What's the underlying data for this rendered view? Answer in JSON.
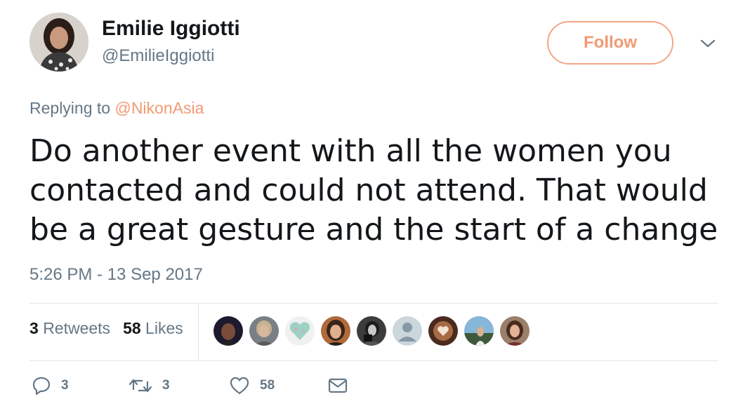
{
  "author": {
    "name": "Emilie Iggiotti",
    "handle": "@EmilieIggiotti",
    "avatar_icon": "profile-photo"
  },
  "follow_button": {
    "label": "Follow",
    "color": "#f09a73"
  },
  "more_menu": {
    "icon": "chevron-down-icon"
  },
  "reply": {
    "prefix": "Replying to",
    "mention": "@NikonAsia"
  },
  "tweet": {
    "text": "Do another event with all the women you contacted and could not attend. That would be a great gesture and the start of a change",
    "timestamp": "5:26 PM - 13 Sep 2017"
  },
  "stats": {
    "retweets_count": "3",
    "retweets_label": "Retweets",
    "likes_count": "58",
    "likes_label": "Likes"
  },
  "likers": [
    "liker-avatar-1",
    "liker-avatar-2",
    "liker-avatar-3",
    "liker-avatar-4",
    "liker-avatar-5",
    "liker-avatar-6",
    "liker-avatar-7",
    "liker-avatar-8",
    "liker-avatar-9"
  ],
  "actions": {
    "reply_count": "3",
    "retweet_count": "3",
    "like_count": "58"
  },
  "colors": {
    "accent": "#f09a73",
    "secondary_text": "#657786",
    "primary_text": "#14171a",
    "divider": "#e1e8ed"
  }
}
